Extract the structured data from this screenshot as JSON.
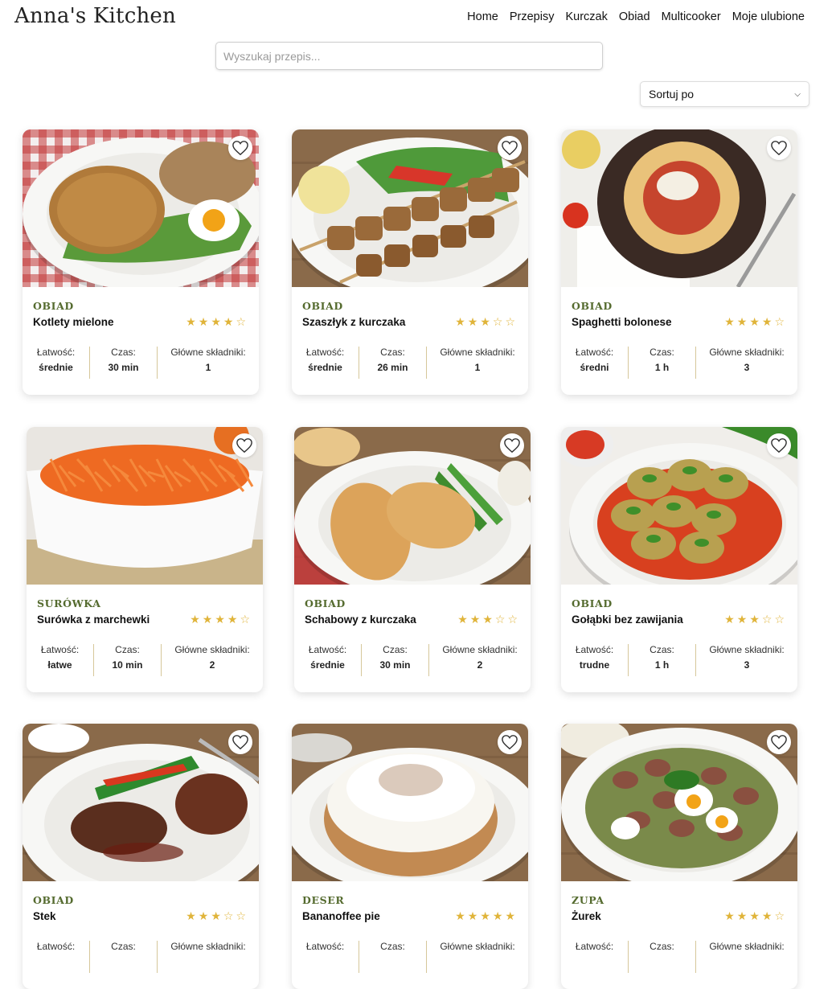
{
  "site": {
    "logo": "Anna's Kitchen"
  },
  "nav": [
    "Home",
    "Przepisy",
    "Kurczak",
    "Obiad",
    "Multicooker",
    "Moje ulubione"
  ],
  "search": {
    "placeholder": "Wyszukaj przepis..."
  },
  "sort": {
    "label": "Sortuj po"
  },
  "stat_labels": {
    "ease": "Łatwość:",
    "time": "Czas:",
    "ingredients": "Główne składniki:"
  },
  "colors": {
    "accent": "#556b2f",
    "star": "#e0b43a",
    "divider": "#d6c79a"
  },
  "recipes": [
    {
      "category": "OBIAD",
      "title": "Kotlety mielone",
      "rating": 4,
      "ease": "średnie",
      "time": "30 min",
      "ingredients": "1",
      "photo": "cutlet"
    },
    {
      "category": "OBIAD",
      "title": "Szaszłyk z kurczaka",
      "rating": 3,
      "ease": "średnie",
      "time": "26 min",
      "ingredients": "1",
      "photo": "skewer"
    },
    {
      "category": "OBIAD",
      "title": "Spaghetti bolonese",
      "rating": 4,
      "ease": "średni",
      "time": "1 h",
      "ingredients": "3",
      "photo": "spaghetti"
    },
    {
      "category": "SURÓWKA",
      "title": "Surówka z marchewki",
      "rating": 4,
      "ease": "łatwe",
      "time": "10 min",
      "ingredients": "2",
      "photo": "carrot"
    },
    {
      "category": "OBIAD",
      "title": "Schabowy z kurczaka",
      "rating": 3,
      "ease": "średnie",
      "time": "30 min",
      "ingredients": "2",
      "photo": "schabowy"
    },
    {
      "category": "OBIAD",
      "title": "Gołąbki bez zawijania",
      "rating": 3,
      "ease": "trudne",
      "time": "1 h",
      "ingredients": "3",
      "photo": "golabki"
    },
    {
      "category": "OBIAD",
      "title": "Stek",
      "rating": 3,
      "ease": "",
      "time": "",
      "ingredients": "",
      "photo": "steak"
    },
    {
      "category": "DESER",
      "title": "Bananoffee pie",
      "rating": 5,
      "ease": "",
      "time": "",
      "ingredients": "",
      "photo": "pie"
    },
    {
      "category": "ZUPA",
      "title": "Żurek",
      "rating": 4,
      "ease": "",
      "time": "",
      "ingredients": "",
      "photo": "zurek"
    }
  ]
}
